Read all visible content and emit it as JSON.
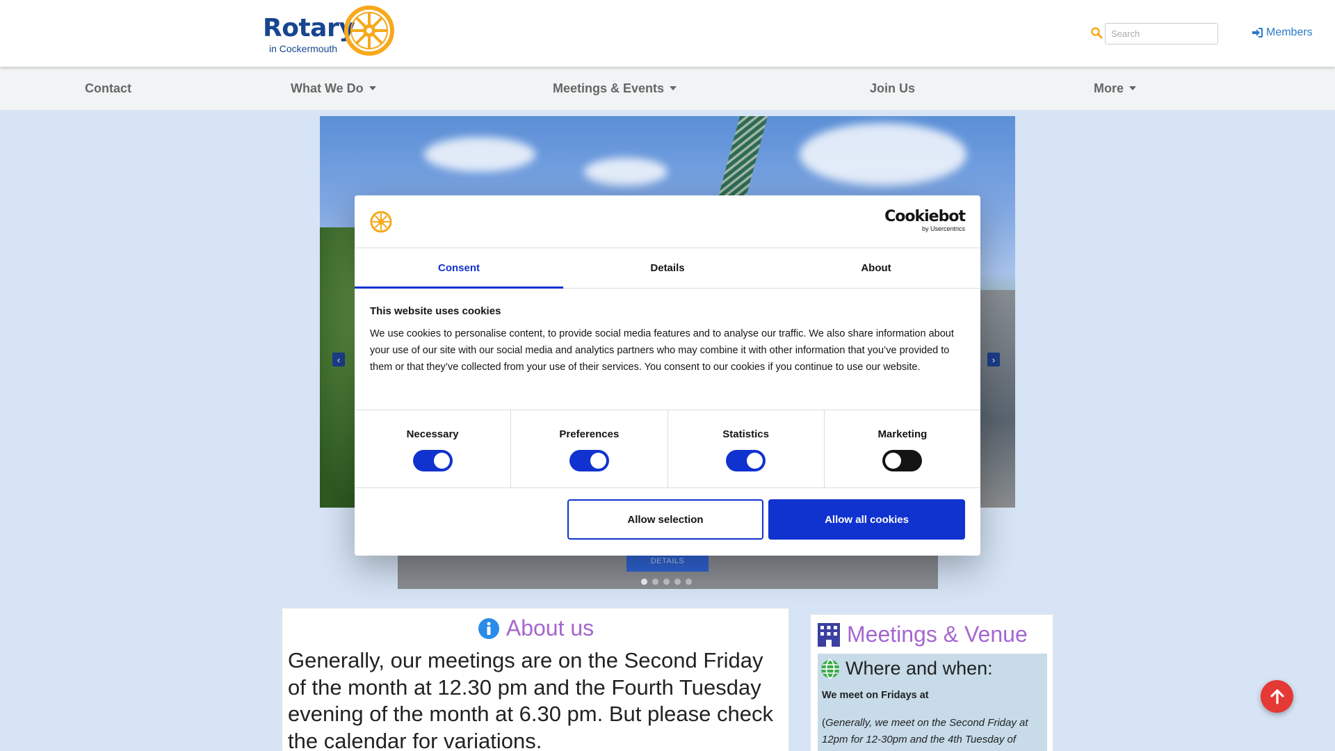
{
  "header": {
    "logo_word": "Rotary",
    "logo_sub": "in Cockermouth",
    "search_placeholder": "Search",
    "members_label": "Members"
  },
  "nav": {
    "items": [
      {
        "label": "Contact",
        "dropdown": false
      },
      {
        "label": "What We Do",
        "dropdown": true
      },
      {
        "label": "Meetings & Events",
        "dropdown": true
      },
      {
        "label": "Join Us",
        "dropdown": false
      },
      {
        "label": "More",
        "dropdown": true
      }
    ]
  },
  "carousel": {
    "details_label": "DETAILS",
    "slide_count": 5,
    "active_slide": 1
  },
  "cookie": {
    "brand": "Cookiebot",
    "brand_by": "by Usercentrics",
    "tabs": [
      "Consent",
      "Details",
      "About"
    ],
    "active_tab": "Consent",
    "title": "This website uses cookies",
    "text": "We use cookies to personalise content, to provide social media features and to analyse our traffic. We also share information about your use of our site with our social media and analytics partners who may combine it with other information that you’ve provided to them or that they’ve collected from your use of their services. You consent to our cookies if you continue to use our website.",
    "toggles": [
      {
        "label": "Necessary",
        "on": true
      },
      {
        "label": "Preferences",
        "on": true
      },
      {
        "label": "Statistics",
        "on": true
      },
      {
        "label": "Marketing",
        "on": false
      }
    ],
    "allow_selection": "Allow selection",
    "allow_all": "Allow all cookies"
  },
  "about": {
    "heading": "About us",
    "text": "Generally, our meetings are on the Second Friday of the month at 12.30 pm and the Fourth Tuesday evening of the month at 6.30 pm. But please check the calendar for variations."
  },
  "venue": {
    "heading": "Meetings & Venue",
    "where_heading": "Where and when:",
    "meet_text": "We meet on Fridays at",
    "generally_open": "(",
    "generally_text": "Generally, we meet on the Second Friday at 12pm for 12-30pm and the 4th Tuesday of"
  },
  "colors": {
    "rotary_blue": "#17458f",
    "rotary_gold": "#f7a81b",
    "cookie_blue": "#1032cf",
    "heading_purple": "#a566cf",
    "fab_red": "#e53935",
    "page_bg": "#d6e4f6"
  },
  "icons": {
    "search": "search-icon",
    "members": "sign-in-icon",
    "info": "info-circle-icon",
    "building": "building-icon",
    "globe": "globe-icon",
    "arrow_up": "arrow-up-icon"
  }
}
